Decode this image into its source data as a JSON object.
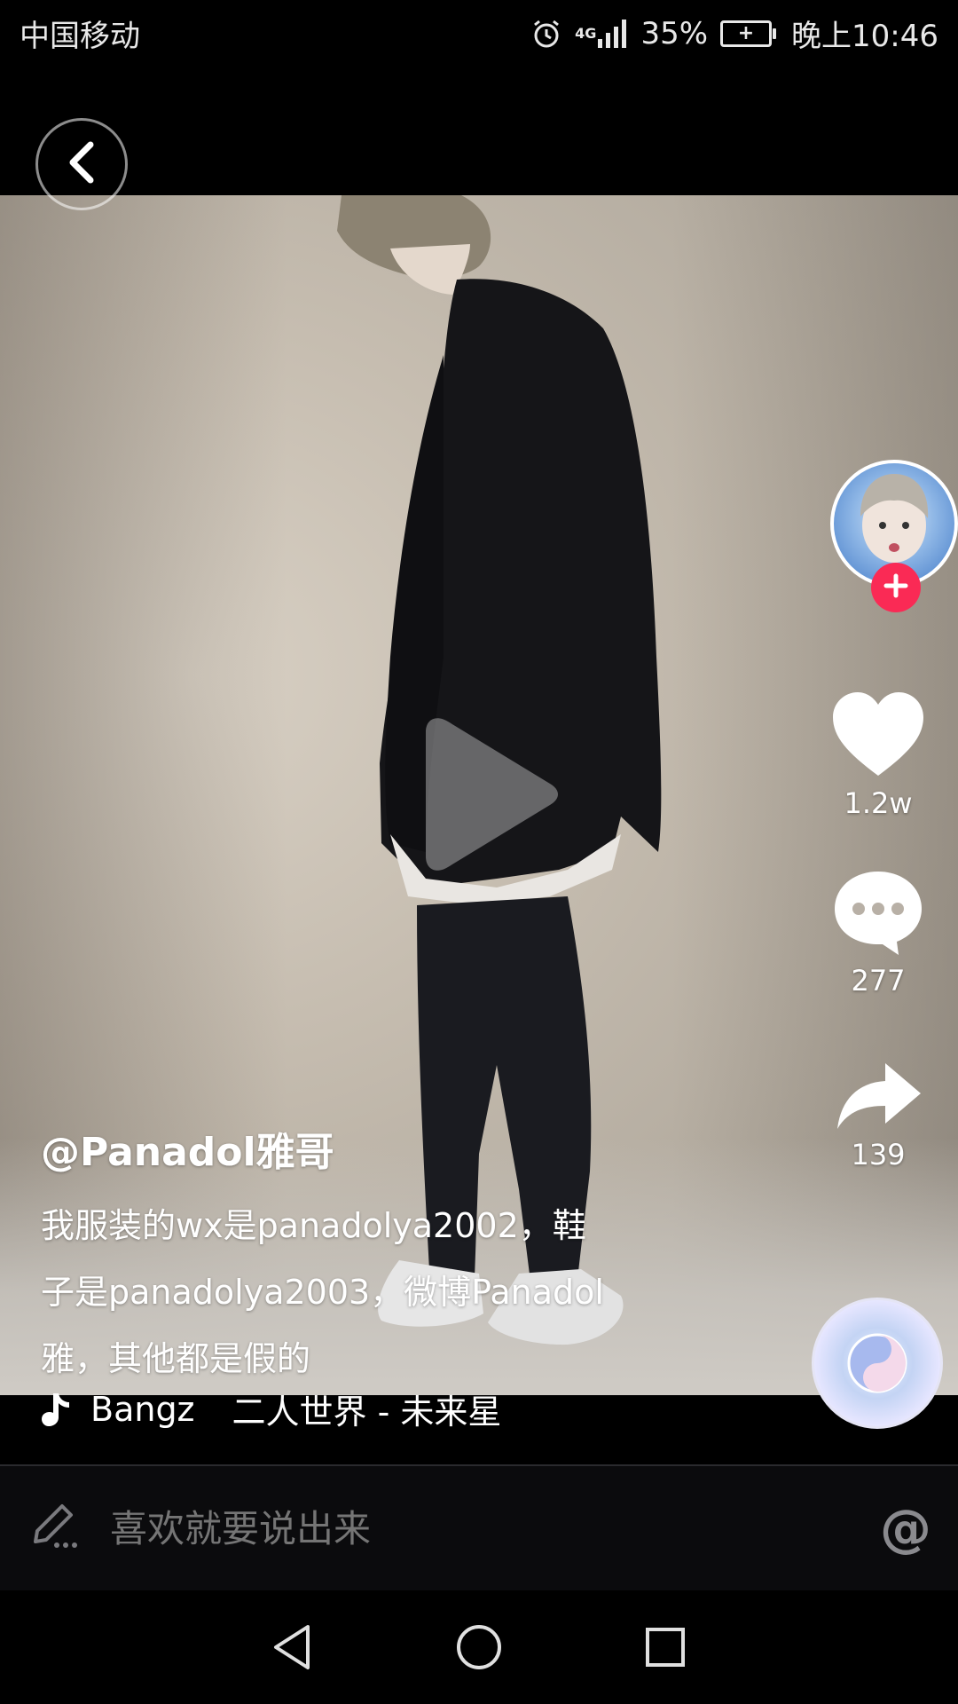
{
  "status_bar": {
    "carrier": "中国移动",
    "network": "4G",
    "battery": "35%",
    "time": "晚上10:46"
  },
  "video": {
    "author": "@Panadol雅哥",
    "description_lines": [
      "我服装的wx是panadolya2002，鞋",
      "子是panadolya2003，微博Panadol",
      "雅，其他都是假的"
    ],
    "music": {
      "artist": "Bangz",
      "title": "二人世界 - 未来星"
    }
  },
  "actions": {
    "likes": "1.2w",
    "comments": "277",
    "shares": "139"
  },
  "comment_bar": {
    "placeholder": "喜欢就要说出来",
    "at_symbol": "@"
  },
  "colors": {
    "accent": "#fa2a55",
    "background": "#000000"
  },
  "icons": [
    "back-icon",
    "play-icon",
    "plus-icon",
    "heart-icon",
    "comment-icon",
    "share-icon",
    "music-note-icon",
    "pencil-icon",
    "nav-back-icon",
    "nav-home-icon",
    "nav-recents-icon"
  ]
}
